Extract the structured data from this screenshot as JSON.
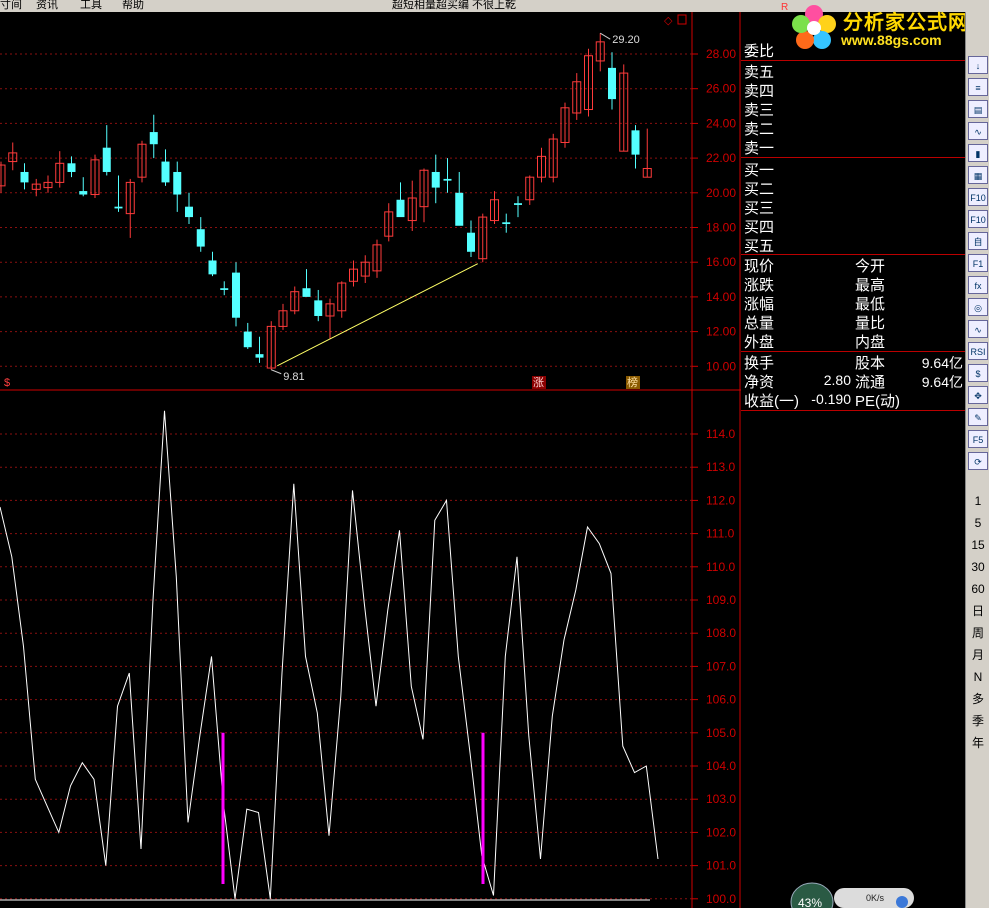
{
  "topbar": {
    "items": [
      "寸间",
      "资讯",
      "工具",
      "帮助"
    ],
    "center_title": "超短相量超买编 不很上乾"
  },
  "logo": {
    "title": "分析家公式网",
    "url": "www.88gs.com",
    "badge": "R"
  },
  "chart_data": [
    {
      "type": "candlestick",
      "yticks": [
        "28.00",
        "26.00",
        "24.00",
        "22.00",
        "20.00",
        "18.00",
        "16.00",
        "14.00",
        "12.00",
        "10.00"
      ],
      "ylim": [
        9.2,
        30.0
      ],
      "annotations": {
        "high": "29.20",
        "low": "9.81"
      },
      "markers": [
        "$",
        "涨",
        "榜"
      ],
      "candles": [
        {
          "o": 20.4,
          "h": 21.8,
          "l": 20.0,
          "c": 21.6,
          "up": true
        },
        {
          "o": 21.8,
          "h": 22.9,
          "l": 21.3,
          "c": 22.3,
          "up": true
        },
        {
          "o": 21.2,
          "h": 21.7,
          "l": 20.2,
          "c": 20.6,
          "up": false
        },
        {
          "o": 20.2,
          "h": 20.8,
          "l": 19.8,
          "c": 20.5,
          "up": true
        },
        {
          "o": 20.3,
          "h": 21.0,
          "l": 20.0,
          "c": 20.6,
          "up": true
        },
        {
          "o": 20.6,
          "h": 22.4,
          "l": 20.3,
          "c": 21.7,
          "up": true
        },
        {
          "o": 21.7,
          "h": 22.1,
          "l": 20.9,
          "c": 21.2,
          "up": false
        },
        {
          "o": 20.1,
          "h": 20.9,
          "l": 19.8,
          "c": 19.9,
          "up": false
        },
        {
          "o": 19.9,
          "h": 22.2,
          "l": 19.7,
          "c": 21.9,
          "up": true
        },
        {
          "o": 22.6,
          "h": 23.9,
          "l": 21.0,
          "c": 21.2,
          "up": false
        },
        {
          "o": 19.2,
          "h": 21.0,
          "l": 18.9,
          "c": 19.1,
          "up": false
        },
        {
          "o": 18.8,
          "h": 20.8,
          "l": 17.4,
          "c": 20.6,
          "up": true
        },
        {
          "o": 20.9,
          "h": 23.0,
          "l": 20.6,
          "c": 22.8,
          "up": true
        },
        {
          "o": 22.8,
          "h": 24.5,
          "l": 22.0,
          "c": 23.5,
          "up": false
        },
        {
          "o": 21.8,
          "h": 22.5,
          "l": 20.4,
          "c": 20.6,
          "up": false
        },
        {
          "o": 21.2,
          "h": 21.8,
          "l": 18.9,
          "c": 19.9,
          "up": false
        },
        {
          "o": 19.2,
          "h": 20.0,
          "l": 18.2,
          "c": 18.6,
          "up": false
        },
        {
          "o": 17.9,
          "h": 18.6,
          "l": 16.6,
          "c": 16.9,
          "up": false
        },
        {
          "o": 16.1,
          "h": 16.6,
          "l": 15.2,
          "c": 15.3,
          "up": false
        },
        {
          "o": 14.5,
          "h": 14.9,
          "l": 14.1,
          "c": 14.4,
          "up": false
        },
        {
          "o": 15.4,
          "h": 16.0,
          "l": 12.3,
          "c": 12.8,
          "up": false
        },
        {
          "o": 12.0,
          "h": 12.5,
          "l": 11.0,
          "c": 11.1,
          "up": false
        },
        {
          "o": 10.7,
          "h": 11.7,
          "l": 10.2,
          "c": 10.5,
          "up": false
        },
        {
          "o": 9.9,
          "h": 12.6,
          "l": 9.8,
          "c": 12.3,
          "up": true
        },
        {
          "o": 12.3,
          "h": 13.6,
          "l": 12.1,
          "c": 13.2,
          "up": true
        },
        {
          "o": 13.2,
          "h": 14.6,
          "l": 13.0,
          "c": 14.3,
          "up": true
        },
        {
          "o": 14.5,
          "h": 15.6,
          "l": 14.1,
          "c": 14.0,
          "up": false
        },
        {
          "o": 13.8,
          "h": 14.4,
          "l": 12.6,
          "c": 12.9,
          "up": false
        },
        {
          "o": 12.9,
          "h": 13.9,
          "l": 11.6,
          "c": 13.6,
          "up": true
        },
        {
          "o": 13.2,
          "h": 14.9,
          "l": 12.8,
          "c": 14.8,
          "up": true
        },
        {
          "o": 14.9,
          "h": 16.1,
          "l": 14.6,
          "c": 15.6,
          "up": true
        },
        {
          "o": 15.2,
          "h": 16.4,
          "l": 14.8,
          "c": 16.0,
          "up": true
        },
        {
          "o": 15.5,
          "h": 17.3,
          "l": 15.1,
          "c": 17.0,
          "up": true
        },
        {
          "o": 17.5,
          "h": 19.4,
          "l": 17.2,
          "c": 18.9,
          "up": true
        },
        {
          "o": 19.6,
          "h": 20.6,
          "l": 18.9,
          "c": 18.6,
          "up": false
        },
        {
          "o": 18.4,
          "h": 20.7,
          "l": 17.8,
          "c": 19.7,
          "up": true
        },
        {
          "o": 19.2,
          "h": 21.4,
          "l": 18.3,
          "c": 21.3,
          "up": true
        },
        {
          "o": 21.2,
          "h": 22.2,
          "l": 19.4,
          "c": 20.3,
          "up": false
        },
        {
          "o": 20.8,
          "h": 22.0,
          "l": 20.0,
          "c": 20.7,
          "up": false
        },
        {
          "o": 20.0,
          "h": 21.2,
          "l": 19.7,
          "c": 18.1,
          "up": false
        },
        {
          "o": 17.7,
          "h": 18.4,
          "l": 16.3,
          "c": 16.6,
          "up": false
        },
        {
          "o": 16.2,
          "h": 18.8,
          "l": 16.0,
          "c": 18.6,
          "up": true
        },
        {
          "o": 18.4,
          "h": 20.1,
          "l": 18.2,
          "c": 19.6,
          "up": true
        },
        {
          "o": 18.2,
          "h": 18.8,
          "l": 17.7,
          "c": 18.3,
          "up": false
        },
        {
          "o": 19.4,
          "h": 19.8,
          "l": 18.6,
          "c": 19.3,
          "up": false
        },
        {
          "o": 19.6,
          "h": 21.0,
          "l": 19.3,
          "c": 20.9,
          "up": true
        },
        {
          "o": 20.9,
          "h": 22.6,
          "l": 20.6,
          "c": 22.1,
          "up": true
        },
        {
          "o": 20.9,
          "h": 23.4,
          "l": 20.6,
          "c": 23.1,
          "up": true
        },
        {
          "o": 22.9,
          "h": 25.2,
          "l": 22.6,
          "c": 24.9,
          "up": true
        },
        {
          "o": 24.6,
          "h": 26.9,
          "l": 24.2,
          "c": 26.4,
          "up": true
        },
        {
          "o": 24.8,
          "h": 28.3,
          "l": 24.4,
          "c": 27.9,
          "up": true
        },
        {
          "o": 27.6,
          "h": 29.2,
          "l": 27.0,
          "c": 28.7,
          "up": true
        },
        {
          "o": 27.2,
          "h": 28.1,
          "l": 24.8,
          "c": 25.4,
          "up": false
        },
        {
          "o": 26.9,
          "h": 27.4,
          "l": 22.4,
          "c": 22.4,
          "up": true
        },
        {
          "o": 23.6,
          "h": 23.9,
          "l": 21.4,
          "c": 22.2,
          "up": false
        },
        {
          "o": 21.4,
          "h": 23.7,
          "l": 20.9,
          "c": 20.9,
          "up": true
        }
      ]
    },
    {
      "type": "line",
      "yticks": [
        "114.0",
        "113.0",
        "112.0",
        "111.0",
        "110.0",
        "109.0",
        "108.0",
        "107.0",
        "106.0",
        "105.0",
        "104.0",
        "103.0",
        "102.0",
        "101.0",
        "100.0"
      ],
      "ylim": [
        100.0,
        114.7
      ],
      "values": [
        111.8,
        110.3,
        107.6,
        103.6,
        102.8,
        102.0,
        103.4,
        104.1,
        103.6,
        101.0,
        105.8,
        106.8,
        101.5,
        108.9,
        114.7,
        109.7,
        102.3,
        104.9,
        107.3,
        102.9,
        100.0,
        102.7,
        102.6,
        100.0,
        106.8,
        112.5,
        107.3,
        105.6,
        101.9,
        106.1,
        112.3,
        108.9,
        105.8,
        108.7,
        111.1,
        106.4,
        104.8,
        111.4,
        112.0,
        107.3,
        104.4,
        101.3,
        100.1,
        107.3,
        110.3,
        104.9,
        101.2,
        105.5,
        107.8,
        109.3,
        111.2,
        110.7,
        109.8,
        104.6,
        103.8,
        104.0,
        101.2
      ],
      "signal_bars": [
        {
          "index": 15,
          "value": 105.0
        },
        {
          "index": 32,
          "value": 105.0
        }
      ]
    }
  ],
  "quotes": {
    "weibi": "委比",
    "sell": [
      "卖五",
      "卖四",
      "卖三",
      "卖二",
      "卖一"
    ],
    "buy": [
      "买一",
      "买二",
      "买三",
      "买四",
      "买五"
    ],
    "stats_left": [
      "现价",
      "涨跌",
      "涨幅",
      "总量",
      "外盘"
    ],
    "stats_right": [
      "今开",
      "最高",
      "最低",
      "量比",
      "内盘"
    ],
    "fin": [
      {
        "l": "换手",
        "m": "",
        "r": "股本",
        "v": "9.64亿"
      },
      {
        "l": "净资",
        "m": "2.80",
        "r": "流通",
        "v": "9.64亿"
      },
      {
        "l": "收益(一)",
        "m": "-0.190",
        "r": "PE(动)",
        "v": ""
      }
    ]
  },
  "toolbar": {
    "icons": [
      "↓",
      "≡",
      "▤",
      "∿",
      "▮",
      "▦",
      "F10",
      "F10",
      "自",
      "F1",
      "fx",
      "◎",
      "∿",
      "RSI",
      "$",
      "✥",
      "✎",
      "F5",
      "⟳"
    ],
    "periods": [
      "1",
      "5",
      "15",
      "30",
      "60",
      "日",
      "周",
      "月",
      "N",
      "多",
      "季",
      "年"
    ]
  },
  "bottom": {
    "percent": "43%",
    "speed": "0K/s"
  }
}
